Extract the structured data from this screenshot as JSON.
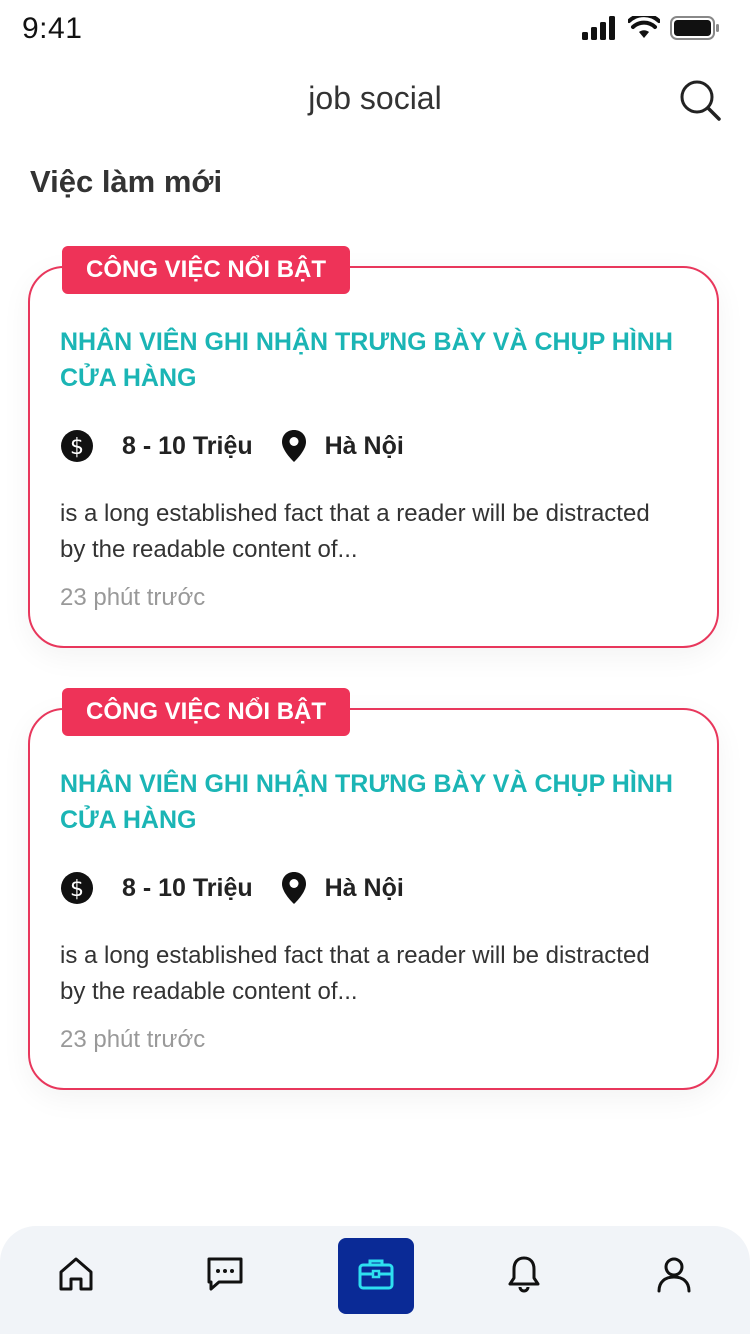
{
  "status_bar": {
    "time": "9:41"
  },
  "header": {
    "title": "job social"
  },
  "section": {
    "title": "Việc làm mới"
  },
  "jobs": [
    {
      "badge": "CÔNG VIỆC NỔI BẬT",
      "title": "NHÂN VIÊN GHI NHẬN TRƯNG BÀY VÀ CHỤP HÌNH CỬA HÀNG",
      "salary": "8 - 10 Triệu",
      "location": "Hà Nội",
      "description": "is a long established fact that a reader will be distracted by the readable content of...",
      "posted": "23 phút trước"
    },
    {
      "badge": "CÔNG VIỆC NỔI BẬT",
      "title": "NHÂN VIÊN GHI NHẬN TRƯNG BÀY VÀ CHỤP HÌNH CỬA HÀNG",
      "salary": "8 - 10 Triệu",
      "location": "Hà Nội",
      "description": "is a long established fact that a reader will be distracted by the readable content of...",
      "posted": "23 phút trước"
    }
  ],
  "bottom_nav": {
    "items": [
      {
        "icon": "home-icon",
        "active": false
      },
      {
        "icon": "message-icon",
        "active": false
      },
      {
        "icon": "briefcase-icon",
        "active": true
      },
      {
        "icon": "bell-icon",
        "active": false
      },
      {
        "icon": "user-icon",
        "active": false
      }
    ]
  },
  "colors": {
    "accent": "#ee3358",
    "card_border": "#e8375c",
    "job_title": "#1bb5b5",
    "nav_active": "#0a2a96",
    "nav_active_icon": "#2ee0f0"
  }
}
